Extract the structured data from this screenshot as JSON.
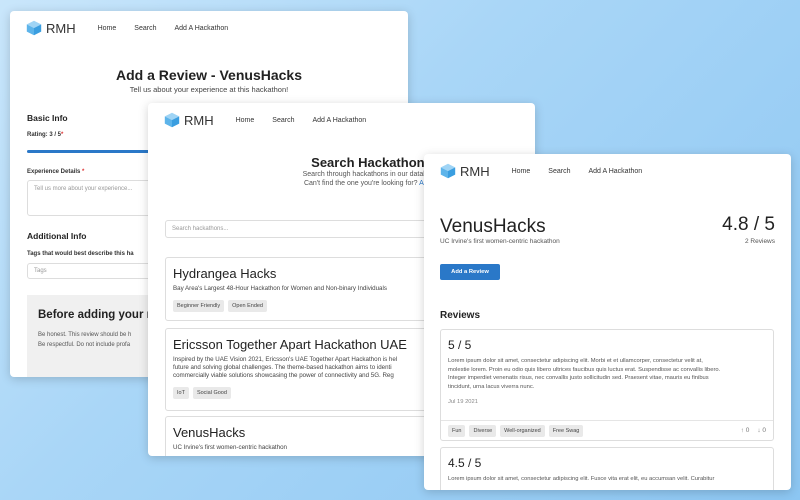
{
  "brand": "RMH",
  "nav": {
    "home": "Home",
    "search": "Search",
    "add": "Add A Hackathon"
  },
  "w1": {
    "title": "Add a Review - VenusHacks",
    "subtitle": "Tell us about your experience at this hackathon!",
    "basic_info": "Basic Info",
    "rating_label": "Rating: 3 / 5",
    "rating_fraction": 0.6,
    "experience_label": "Experience Details",
    "experience_placeholder": "Tell us more about your experience...",
    "additional_info": "Additional Info",
    "tags_label": "Tags that would best describe this ha",
    "tags_placeholder": "Tags",
    "before_heading": "Before adding your r",
    "before_line1": "Be honest. This review should be h",
    "before_line2": "Be respectful. Do not include profa"
  },
  "w2": {
    "title": "Search Hackathons",
    "sub1": "Search through hackathons in our database.",
    "sub2": "Can't find the one you're looking for?",
    "add_link": "Add it!",
    "search_placeholder": "Search hackathons...",
    "cards": [
      {
        "title": "Hydrangea Hacks",
        "desc": "Bay Area's Largest 48-Hour Hackathon for Women and Non-binary Individuals",
        "tags": [
          "Beginner Friendly",
          "Open Ended"
        ]
      },
      {
        "title": "Ericsson Together Apart Hackathon UAE",
        "desc1": "Inspired by the UAE Vision 2021, Ericsson's UAE Together Apart Hackathon is hel",
        "desc2": "future and solving global challenges. The theme-based hackathon aims to identi",
        "desc3": "commercially viable solutions showcasing the power of connectivity and 5G. Reg",
        "tags": [
          "IoT",
          "Social Good"
        ]
      },
      {
        "title": "VenusHacks",
        "desc": "UC Irvine's first women-centric hackathon"
      }
    ]
  },
  "w3": {
    "title": "VenusHacks",
    "subtitle": "UC Irvine's first women-centric hackathon",
    "rating": "4.8 / 5",
    "review_count": "2 Reviews",
    "add_review": "Add a Review",
    "reviews_heading": "Reviews",
    "reviews": [
      {
        "score": "5 / 5",
        "l1": "Lorem ipsum dolor sit amet, consectetur adipiscing elit. Morbi et et ullamcorper, consectetur velit at,",
        "l2": "molestie lorem. Proin eu odio quis libero ultrices faucibus quis luctus erat. Suspendisse ac convallis libero.",
        "l3": "Integer imperdiet venenatis risus, nec convallis justo sollicitudin sed. Praesent vitae, mauris eu finibus",
        "l4": "tincidunt, urna lacus viverra nunc.",
        "date": "Jul 19 2021",
        "tags": [
          "Fun",
          "Diverse",
          "Well-organized",
          "Free Swag"
        ],
        "up": "0",
        "down": "0"
      },
      {
        "score": "4.5 / 5",
        "l1": "Lorem ipsum dolor sit amet, consectetur adipiscing elit. Fusce vita erat elit, eu accumsan velit. Curabitur"
      }
    ]
  }
}
